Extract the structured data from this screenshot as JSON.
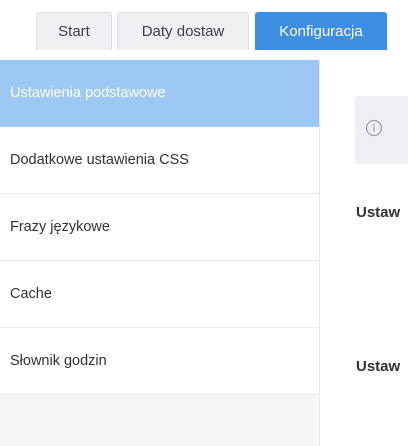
{
  "tabs": [
    {
      "label": "Start"
    },
    {
      "label": "Daty dostaw"
    },
    {
      "label": "Konfiguracja",
      "active": true
    }
  ],
  "sidebar": {
    "items": [
      {
        "label": "Ustawienia podstawowe",
        "active": true
      },
      {
        "label": "Dodatkowe ustawienia CSS"
      },
      {
        "label": "Frazy językowe"
      },
      {
        "label": "Cache"
      },
      {
        "label": "Słownik godzin"
      }
    ]
  },
  "main": {
    "info_icon": "info-circle-icon",
    "headings": [
      "Ustaw",
      "Ustaw"
    ]
  },
  "colors": {
    "accent": "#3b8ee0",
    "active_sidebar": "#9cc8f3"
  }
}
